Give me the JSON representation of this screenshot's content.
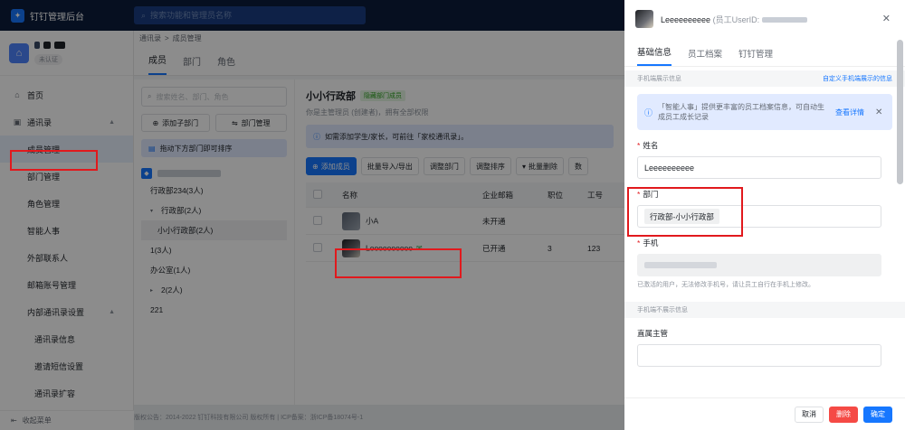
{
  "app": {
    "title": "钉钉管理后台",
    "search_placeholder": "搜索功能和管理员名称",
    "org_badge": "未认证"
  },
  "sidebar": {
    "items": [
      {
        "label": "首页",
        "icon": "home-icon",
        "level": 0
      },
      {
        "label": "通讯录",
        "icon": "contacts-icon",
        "level": 0,
        "expanded": true
      },
      {
        "label": "成员管理",
        "level": 1,
        "active": true
      },
      {
        "label": "部门管理",
        "level": 1
      },
      {
        "label": "角色管理",
        "level": 1
      },
      {
        "label": "智能人事",
        "level": 1
      },
      {
        "label": "外部联系人",
        "level": 1
      },
      {
        "label": "邮箱账号管理",
        "level": 1
      },
      {
        "label": "内部通讯录设置",
        "level": 1,
        "expanded": true
      },
      {
        "label": "通讯录信息",
        "level": 2
      },
      {
        "label": "邀请短信设置",
        "level": 2
      },
      {
        "label": "通讯录扩容",
        "level": 2
      }
    ],
    "collapse_label": "收起菜单"
  },
  "breadcrumb": {
    "parent": "通讯录",
    "sep": ">",
    "current": "成员管理"
  },
  "tabs": [
    "成员",
    "部门",
    "角色"
  ],
  "dept_panel": {
    "search_placeholder": "搜索姓名、部门、角色",
    "add_sub_dept": "添加子部门",
    "dept_manage": "部门管理",
    "tip": "拖动下方部门即可排序",
    "tree": [
      {
        "label": "行政部234(3人)",
        "arrow": ""
      },
      {
        "label": "行政部(2人)",
        "arrow": "▾"
      },
      {
        "label": "小小行政部(2人)",
        "arrow": "",
        "selected": true
      },
      {
        "label": "1(3人)",
        "arrow": ""
      },
      {
        "label": "办公室(1人)",
        "arrow": ""
      },
      {
        "label": "2(2人)",
        "arrow": "▸"
      },
      {
        "label": "221",
        "arrow": ""
      }
    ]
  },
  "members": {
    "title": "小小行政部",
    "badge": "隐藏部门成员",
    "subtitle": "你是主管理员 (创建者)，拥有全部权限",
    "tip": "如需添加学生/家长，可前往「家校通讯录」。",
    "buttons": [
      "添加成员",
      "批量导入/导出",
      "调整部门",
      "调整排序",
      "批量删除",
      "数"
    ],
    "columns": [
      "",
      "名称",
      "企业邮箱",
      "职位",
      "工号"
    ],
    "rows": [
      {
        "name": "小A",
        "email": "未开通",
        "position": "",
        "job_no": ""
      },
      {
        "name": "Leeeeeeeeee",
        "email": "已开通",
        "position": "3",
        "job_no": "123"
      }
    ]
  },
  "footer_text": "版权公告：2014-2022 钉钉科技有限公司 版权所有 | ICP备案：浙ICP备18074号-1",
  "drawer": {
    "name": "Leeeeeeeeee",
    "uid_label": "(员工UserID:",
    "tabs": [
      "基础信息",
      "员工档案",
      "钉钉管理"
    ],
    "section_display": "手机端展示信息",
    "section_link": "自定义手机端展示的信息",
    "notice": "「智能人事」提供更丰富的员工档案信息，可自动生成员工成长记录",
    "notice_link": "查看详情",
    "name_label": "姓名",
    "name_value": "Leeeeeeeeee",
    "dept_label": "部门",
    "dept_value": "行政部-小小行政部",
    "phone_label": "手机",
    "phone_hint": "已激活的用户，无法修改手机号，请让员工自行在手机上修改。",
    "section_hidden": "手机端不展示信息",
    "manager_label": "直属主管",
    "cancel": "取消",
    "delete": "删除",
    "confirm": "确定"
  },
  "colors": {
    "topbar": "#0b1c3b",
    "accent": "#1677ff",
    "highlight": "#e1191d",
    "danger": "#f54a45"
  }
}
